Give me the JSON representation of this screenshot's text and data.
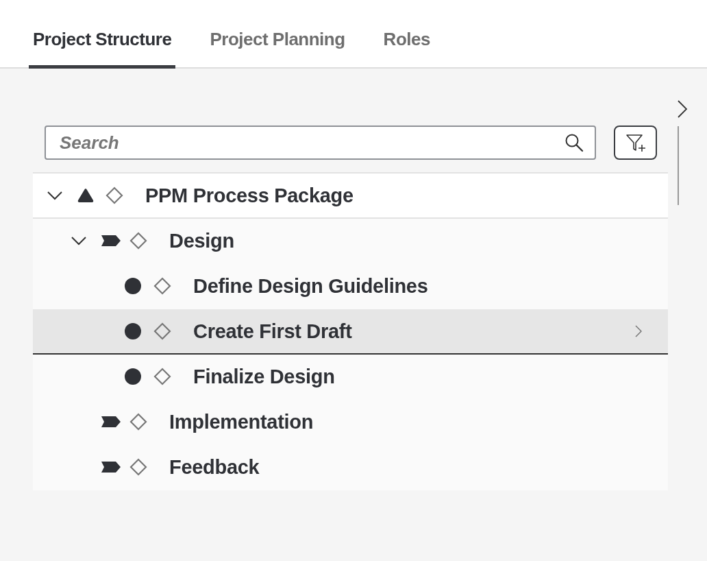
{
  "tabs": [
    {
      "label": "Project Structure",
      "selected": true
    },
    {
      "label": "Project Planning",
      "selected": false
    },
    {
      "label": "Roles",
      "selected": false
    }
  ],
  "search": {
    "placeholder": "Search"
  },
  "tree": [
    {
      "label": "PPM Process Package",
      "kind": "package",
      "expanded": true,
      "selected": false,
      "children": [
        {
          "label": "Design",
          "kind": "phase",
          "expanded": true,
          "selected": false,
          "children": [
            {
              "label": "Define Design Guidelines",
              "kind": "activity",
              "selected": false
            },
            {
              "label": "Create First Draft",
              "kind": "activity",
              "selected": true
            },
            {
              "label": "Finalize Design",
              "kind": "activity",
              "selected": false
            }
          ]
        },
        {
          "label": "Implementation",
          "kind": "phase",
          "selected": false
        },
        {
          "label": "Feedback",
          "kind": "phase",
          "selected": false
        }
      ]
    }
  ]
}
